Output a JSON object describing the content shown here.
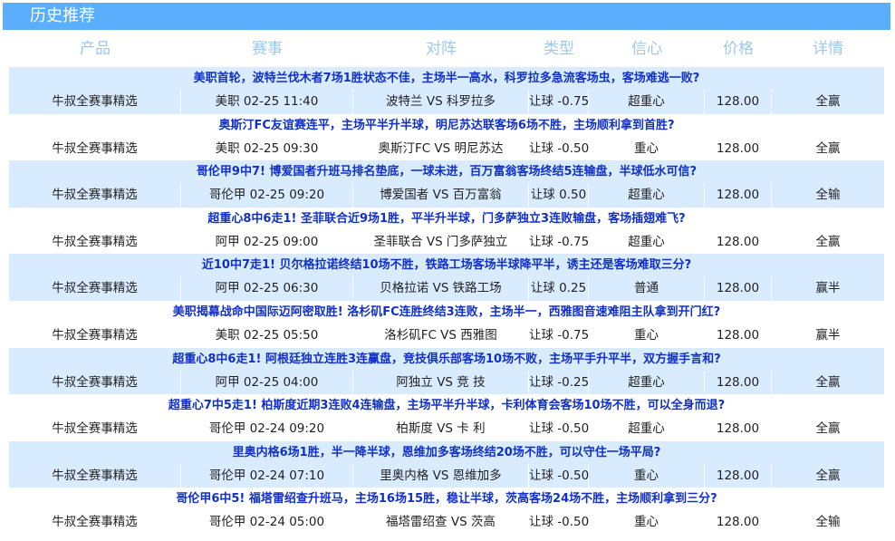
{
  "title": "历史推荐",
  "columns": [
    "产品",
    "赛事",
    "对阵",
    "类型",
    "信心",
    "价格",
    "详情"
  ],
  "rows": [
    {
      "headline": "美职首轮，波特兰伐木者7场1胜状态不佳，主场半一高水，科罗拉多急流客场虫，客场难逃一败?",
      "product": "牛叔全赛事精选",
      "match": "美职 02-25 11:40",
      "teams": "波特兰 VS 科罗拉多",
      "type": "让球 -0.75",
      "confidence": "超重心",
      "price": "128.00",
      "result": "全赢"
    },
    {
      "headline": "奥斯汀FC友谊赛连平，主场平半升半球，明尼苏达联客场6场不胜，主场顺利拿到首胜?",
      "product": "牛叔全赛事精选",
      "match": "美职 02-25 09:30",
      "teams": "奥斯汀FC VS 明尼苏达",
      "type": "让球 -0.50",
      "confidence": "重心",
      "price": "128.00",
      "result": "全赢"
    },
    {
      "headline": "哥伦甲9中7! 博爱国者升班马排名垫底，一球未进，百万富翁客场终结5连输盘，半球低水可信?",
      "product": "牛叔全赛事精选",
      "match": "哥伦甲 02-25 09:20",
      "teams": "博爱国者 VS 百万富翁",
      "type": "让球 0.50",
      "confidence": "超重心",
      "price": "128.00",
      "result": "全输"
    },
    {
      "headline": "超重心8中6走1! 圣菲联合近9场1胜，平半升半球，门多萨独立3连败输盘，客场插翅难飞?",
      "product": "牛叔全赛事精选",
      "match": "阿甲 02-25 09:00",
      "teams": "圣菲联合 VS 门多萨独立",
      "type": "让球 -0.75",
      "confidence": "超重心",
      "price": "128.00",
      "result": "全赢"
    },
    {
      "headline": "近10中7走1! 贝尔格拉诺终结10场不胜，铁路工场客场半球降平半，诱主还是客场难取三分?",
      "product": "牛叔全赛事精选",
      "match": "阿甲 02-25 06:30",
      "teams": "贝格拉诺 VS 铁路工场",
      "type": "让球 0.25",
      "confidence": "普通",
      "price": "128.00",
      "result": "赢半"
    },
    {
      "headline": "美职揭幕战命中国际迈阿密取胜! 洛杉矶FC连胜终结3连败，主场半一，西雅图音速难阻主队拿到开门红?",
      "product": "牛叔全赛事精选",
      "match": "美职 02-25 05:50",
      "teams": "洛杉矶FC VS 西雅图",
      "type": "让球 -0.75",
      "confidence": "重心",
      "price": "128.00",
      "result": "赢半"
    },
    {
      "headline": "超重心8中6走1! 阿根廷独立连胜3连赢盘，竞技俱乐部客场10场不败，主场平手升平半，双方握手言和?",
      "product": "牛叔全赛事精选",
      "match": "阿甲 02-25 04:00",
      "teams": "阿独立 VS 竞 技",
      "type": "让球 -0.25",
      "confidence": "超重心",
      "price": "128.00",
      "result": "全赢"
    },
    {
      "headline": "超重心7中5走1! 柏斯度近期3连败4连输盘，主场平半升半球，卡利体育会客场10场不胜，可以全身而退?",
      "product": "牛叔全赛事精选",
      "match": "哥伦甲 02-24 09:20",
      "teams": "柏斯度 VS 卡 利",
      "type": "让球 -0.50",
      "confidence": "超重心",
      "price": "128.00",
      "result": "全赢"
    },
    {
      "headline": "里奥内格6场1胜，半一降半球，恩维加多客场终结20场不胜，可以守住一场平局?",
      "product": "牛叔全赛事精选",
      "match": "哥伦甲 02-24 07:10",
      "teams": "里奥内格 VS 恩维加多",
      "type": "让球 -0.50",
      "confidence": "重心",
      "price": "128.00",
      "result": "全赢"
    },
    {
      "headline": "哥伦甲6中5! 福塔雷绍查升班马，主场16场15胜，稳让半球，茨高客场24场不胜，主场顺利拿到三分?",
      "product": "牛叔全赛事精选",
      "match": "哥伦甲 02-24 05:00",
      "teams": "福塔雷绍查 VS 茨高",
      "type": "让球 -0.50",
      "confidence": "重心",
      "price": "128.00",
      "result": "全输"
    }
  ]
}
